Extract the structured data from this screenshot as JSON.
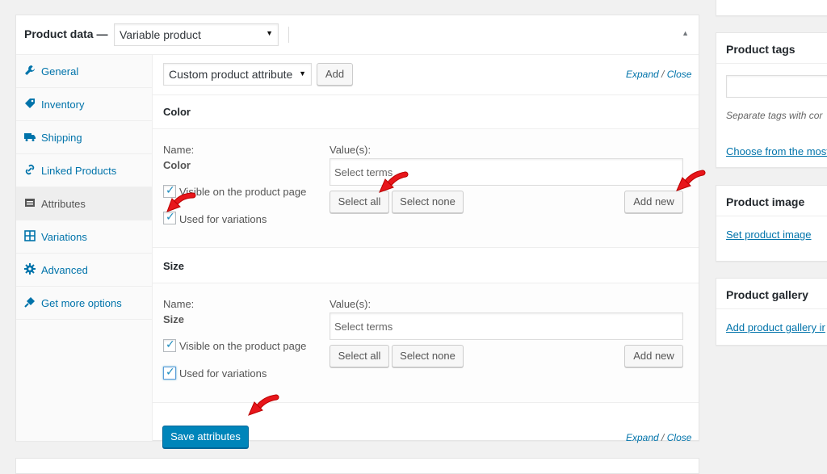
{
  "product_data": {
    "title": "Product data —",
    "type_value": "Variable product"
  },
  "tabs": [
    {
      "label": "General",
      "icon": "wrench-icon"
    },
    {
      "label": "Inventory",
      "icon": "tag-icon"
    },
    {
      "label": "Shipping",
      "icon": "truck-icon"
    },
    {
      "label": "Linked Products",
      "icon": "link-icon"
    },
    {
      "label": "Attributes",
      "icon": "list-icon"
    },
    {
      "label": "Variations",
      "icon": "grid-icon"
    },
    {
      "label": "Advanced",
      "icon": "gear-icon"
    },
    {
      "label": "Get more options",
      "icon": "plugin-icon"
    }
  ],
  "toolbar": {
    "attribute_select": "Custom product attribute",
    "add_label": "Add",
    "expand": "Expand",
    "slash": "/",
    "close": "Close"
  },
  "attributes": [
    {
      "heading": "Color",
      "name_label": "Name:",
      "name_value": "Color",
      "values_label": "Value(s):",
      "terms_placeholder": "Select terms",
      "visible_label": "Visible on the product page",
      "visible_checked": true,
      "variations_label": "Used for variations",
      "variations_checked": true,
      "select_all": "Select all",
      "select_none": "Select none",
      "add_new": "Add new"
    },
    {
      "heading": "Size",
      "name_label": "Name:",
      "name_value": "Size",
      "values_label": "Value(s):",
      "terms_placeholder": "Select terms",
      "visible_label": "Visible on the product page",
      "visible_checked": true,
      "variations_label": "Used for variations",
      "variations_checked": true,
      "select_all": "Select all",
      "select_none": "Select none",
      "add_new": "Add new"
    }
  ],
  "save_label": "Save attributes",
  "sidebar": {
    "tags_title": "Product tags",
    "tags_hint": "Separate tags with cor",
    "tags_choose": "Choose from the most",
    "image_title": "Product image",
    "image_link": "Set product image",
    "gallery_title": "Product gallery",
    "gallery_link": "Add product gallery ir"
  },
  "colors": {
    "accent": "#0073aa",
    "primary_button": "#0085ba",
    "annotation_arrow": "#e8161b"
  }
}
